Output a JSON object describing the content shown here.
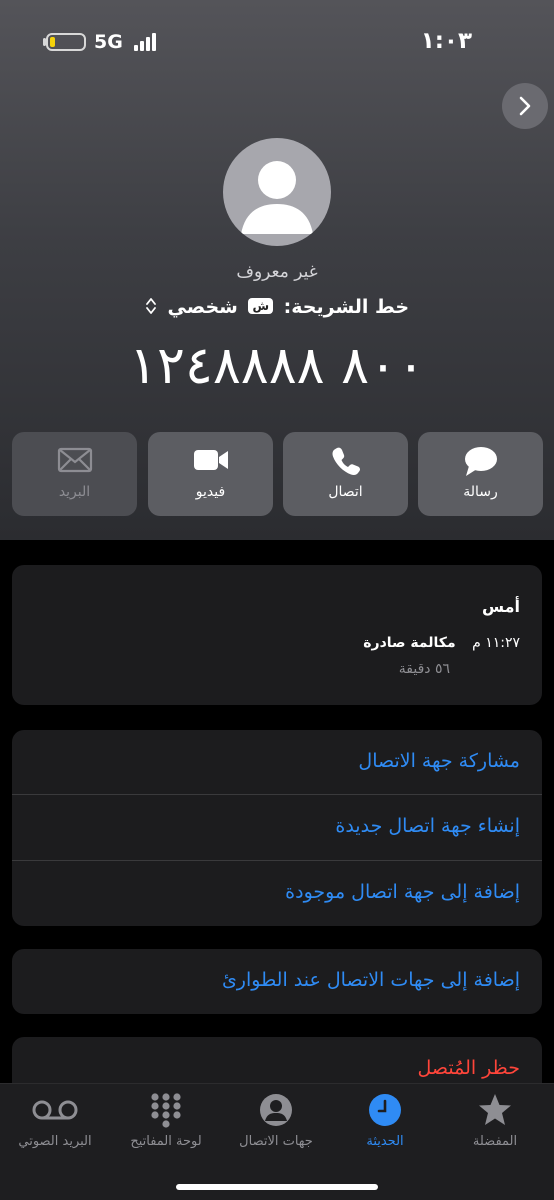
{
  "status_bar": {
    "time": "١:٠٣",
    "network": "5G",
    "battery_level_fraction": 0.15,
    "battery_color": "#f5d20a"
  },
  "contact": {
    "name": "غير معروف",
    "sim_label": "خط الشريحة:",
    "sim_badge": "ش",
    "sim_value": "شخصي",
    "phone_number": "٨٠٠ ١٢٤٨٨٨٨"
  },
  "actions": [
    {
      "label": "رسالة",
      "icon": "message-bubble-icon",
      "enabled": true
    },
    {
      "label": "اتصال",
      "icon": "phone-icon",
      "enabled": true
    },
    {
      "label": "فيديو",
      "icon": "video-camera-icon",
      "enabled": true
    },
    {
      "label": "البريد",
      "icon": "mail-envelope-icon",
      "enabled": false
    }
  ],
  "recents": {
    "day": "أمس",
    "time": "١١:٢٧ م",
    "call_type": "مكالمة صادرة",
    "duration": "٥٦ دقيقة"
  },
  "menu": {
    "share_contact": "مشاركة جهة الاتصال",
    "create_new_contact": "إنشاء جهة اتصال جديدة",
    "add_to_existing": "إضافة إلى جهة اتصال موجودة",
    "add_to_emergency": "إضافة إلى جهات الاتصال عند الطوارئ",
    "block_caller": "حظر المُتصل"
  },
  "colors": {
    "accent": "#2f8bf4",
    "destructive": "#ff453a",
    "card_bg": "#1c1c1e"
  },
  "tab_bar": {
    "tabs": [
      {
        "label": "المفضلة",
        "icon": "star-icon",
        "active": false
      },
      {
        "label": "الحديثة",
        "icon": "clock-icon",
        "active": true
      },
      {
        "label": "جهات الاتصال",
        "icon": "person-circle-icon",
        "active": false
      },
      {
        "label": "لوحة المفاتيح",
        "icon": "keypad-icon",
        "active": false
      },
      {
        "label": "البريد الصوتي",
        "icon": "voicemail-icon",
        "active": false
      }
    ]
  }
}
